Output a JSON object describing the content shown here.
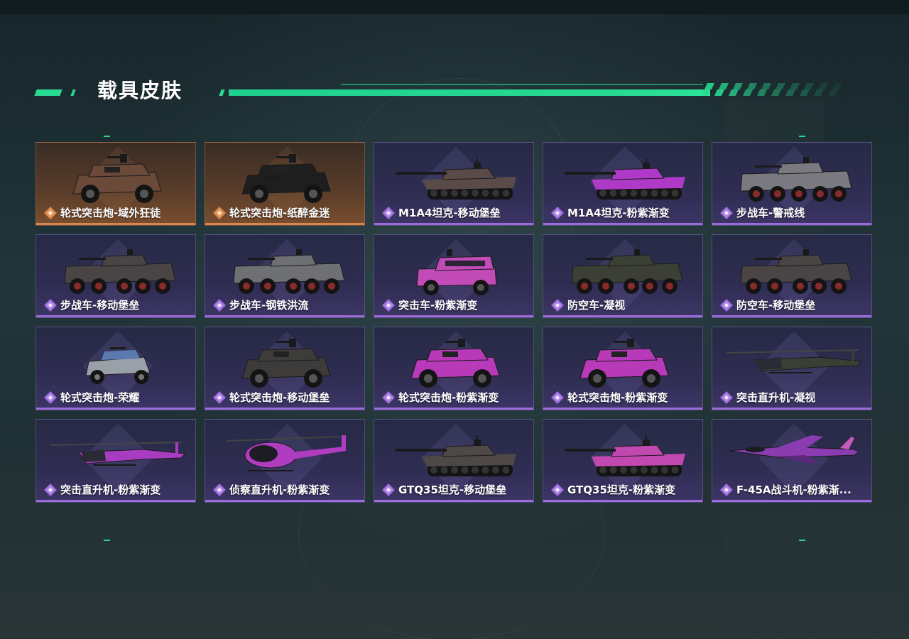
{
  "page": {
    "title": "载具皮肤"
  },
  "colors": {
    "accent_green": "#28d992",
    "rarity_purple": "#9d6cdc",
    "rarity_orange": "#d9874a"
  },
  "cards": [
    {
      "label": "轮式突击炮-域外狂徒",
      "rarity": "orange",
      "vehicle": "armored-car",
      "color": "#6b4a3a",
      "icon": "rarity-orange-icon"
    },
    {
      "label": "轮式突击炮-纸醉金迷",
      "rarity": "orange",
      "vehicle": "armored-car",
      "color": "#1e1e1e",
      "icon": "rarity-orange-icon"
    },
    {
      "label": "M1A4坦克-移动堡垒",
      "rarity": "purple",
      "vehicle": "tank",
      "color": "#5a4a48",
      "icon": "rarity-purple-icon"
    },
    {
      "label": "M1A4坦克-粉紫渐变",
      "rarity": "purple",
      "vehicle": "tank",
      "color": "#b03ac8",
      "icon": "rarity-purple-icon"
    },
    {
      "label": "步战车-警戒线",
      "rarity": "purple",
      "vehicle": "apc",
      "color": "#7a7a80",
      "icon": "rarity-purple-icon"
    },
    {
      "label": "步战车-移动堡垒",
      "rarity": "purple",
      "vehicle": "apc8",
      "color": "#4a4444",
      "icon": "rarity-purple-icon"
    },
    {
      "label": "步战车-钢铁洪流",
      "rarity": "purple",
      "vehicle": "apc8",
      "color": "#6e7074",
      "icon": "rarity-purple-icon"
    },
    {
      "label": "突击车-粉紫渐变",
      "rarity": "purple",
      "vehicle": "suv",
      "color": "#c24bb8",
      "icon": "rarity-purple-icon"
    },
    {
      "label": "防空车-凝视",
      "rarity": "purple",
      "vehicle": "apc8",
      "color": "#3c4034",
      "icon": "rarity-purple-icon"
    },
    {
      "label": "防空车-移动堡垒",
      "rarity": "purple",
      "vehicle": "apc8",
      "color": "#4a4444",
      "icon": "rarity-purple-icon"
    },
    {
      "label": "轮式突击炮-荣耀",
      "rarity": "purple",
      "vehicle": "buggy",
      "color": "#9aa0a8",
      "icon": "rarity-purple-icon"
    },
    {
      "label": "轮式突击炮-移动堡垒",
      "rarity": "purple",
      "vehicle": "armored-car",
      "color": "#3e3c3a",
      "icon": "rarity-purple-icon"
    },
    {
      "label": "轮式突击炮-粉紫渐变",
      "rarity": "purple",
      "vehicle": "armored-car",
      "color": "#b83ab8",
      "icon": "rarity-purple-icon"
    },
    {
      "label": "轮式突击炮-粉紫渐变",
      "rarity": "purple",
      "vehicle": "armored-car",
      "color": "#b83ab8",
      "icon": "rarity-purple-icon"
    },
    {
      "label": "突击直升机-凝视",
      "rarity": "purple",
      "vehicle": "helicopter",
      "color": "#3a3f36",
      "icon": "rarity-purple-icon"
    },
    {
      "label": "突击直升机-粉紫渐变",
      "rarity": "purple",
      "vehicle": "helicopter",
      "color": "#a83cc0",
      "icon": "rarity-purple-icon"
    },
    {
      "label": "侦察直升机-粉紫渐变",
      "rarity": "purple",
      "vehicle": "scout-heli",
      "color": "#b03cc0",
      "icon": "rarity-purple-icon"
    },
    {
      "label": "GTQ35坦克-移动堡垒",
      "rarity": "purple",
      "vehicle": "tank",
      "color": "#4e4846",
      "icon": "rarity-purple-icon"
    },
    {
      "label": "GTQ35坦克-粉紫渐变",
      "rarity": "purple",
      "vehicle": "tank",
      "color": "#c048b0",
      "icon": "rarity-purple-icon"
    },
    {
      "label": "F-45A战斗机-粉紫渐...",
      "rarity": "purple",
      "vehicle": "jet",
      "color": "#8a3cb0",
      "icon": "rarity-purple-icon"
    }
  ]
}
